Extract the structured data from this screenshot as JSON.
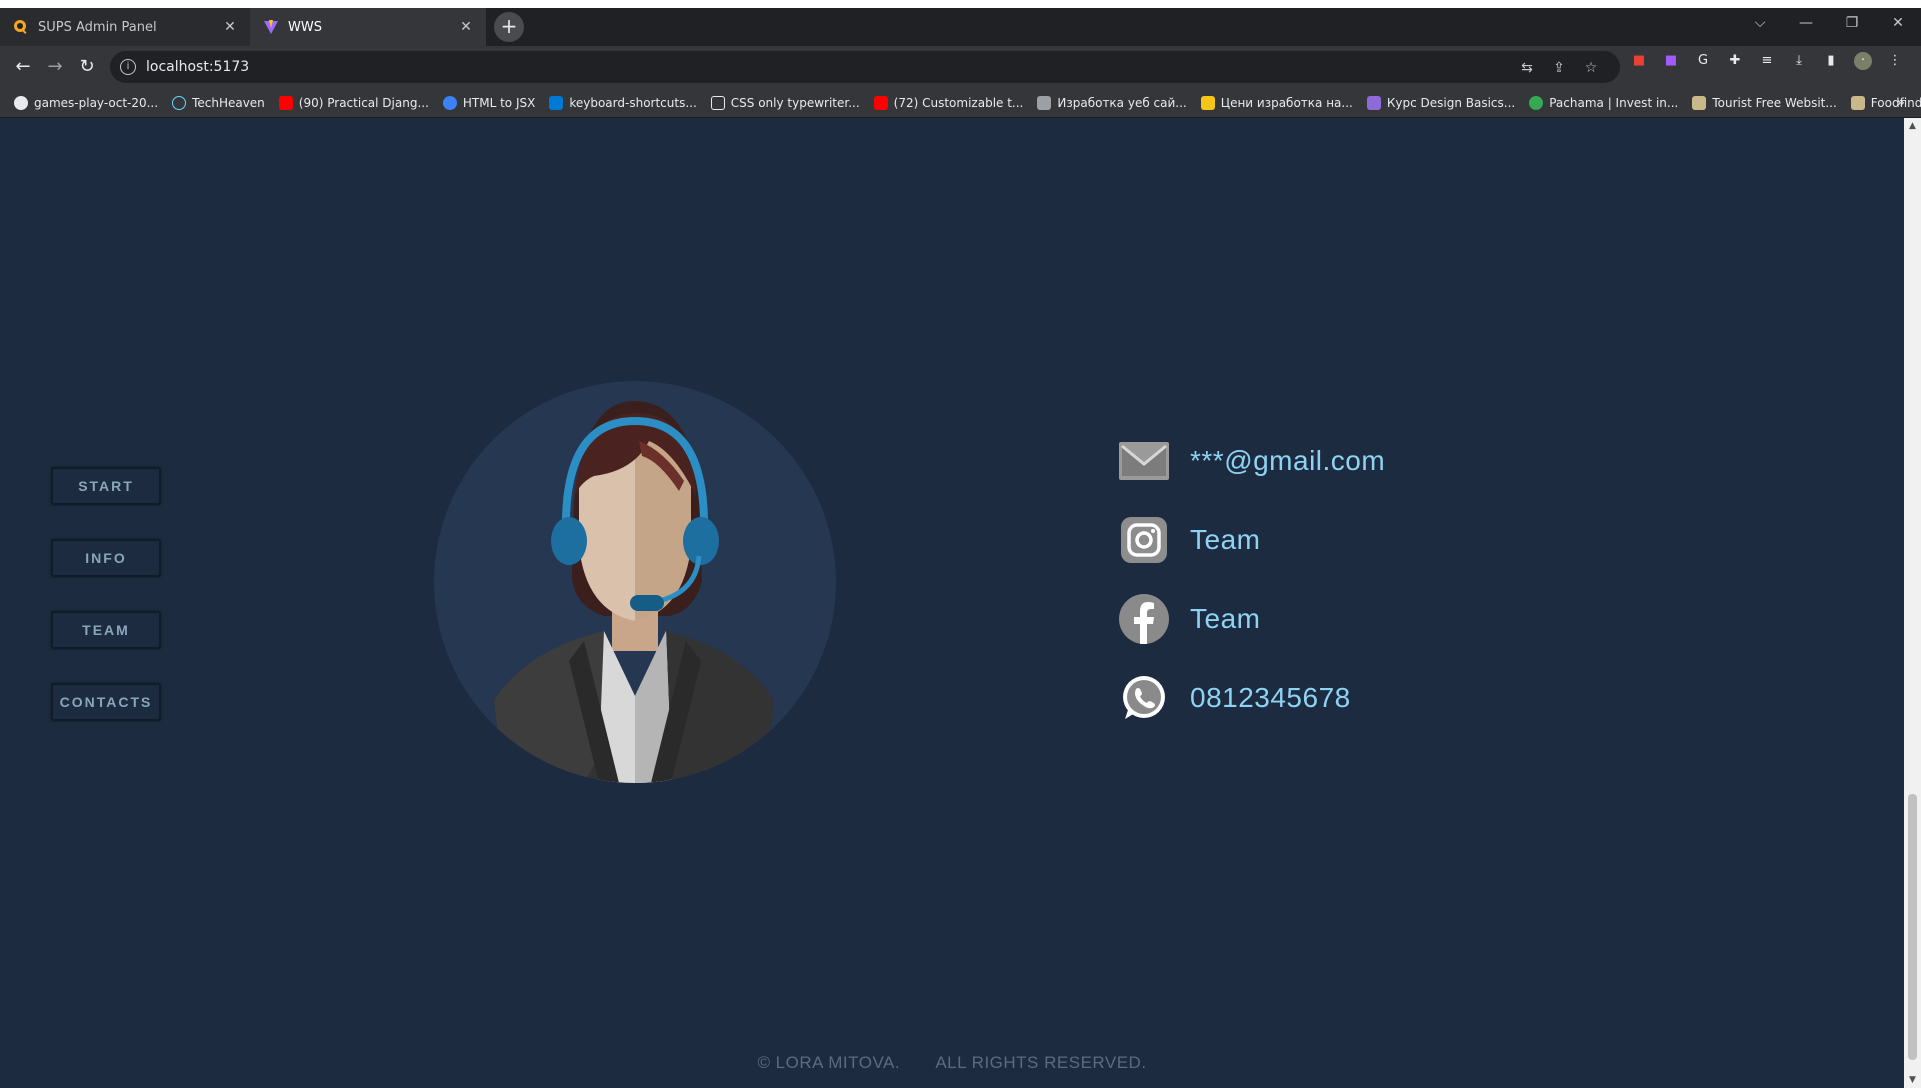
{
  "browser": {
    "tabs": [
      {
        "title": "SUPS Admin Panel",
        "active": false
      },
      {
        "title": "WWS",
        "active": true
      }
    ],
    "new_tab": "+",
    "window_controls": [
      "⌵",
      "—",
      "❐",
      "✕"
    ],
    "address": "localhost:5173",
    "bookmarks": [
      {
        "label": "games-play-oct-20...",
        "color": "#e8eaed"
      },
      {
        "label": "TechHeaven",
        "color": "#61dafb"
      },
      {
        "label": "(90) Practical Djang...",
        "color": "#ff0000"
      },
      {
        "label": "HTML to JSX",
        "color": "#3b82f6"
      },
      {
        "label": "keyboard-shortcuts...",
        "color": "#0078d4"
      },
      {
        "label": "CSS only typewriter...",
        "color": "#e8eaed"
      },
      {
        "label": "(72) Customizable t...",
        "color": "#ff0000"
      },
      {
        "label": "Изработка уеб сай...",
        "color": "#9aa0a6"
      },
      {
        "label": "Цени изработка на...",
        "color": "#f5c518"
      },
      {
        "label": "Курс Design Basics...",
        "color": "#8e6bd8"
      },
      {
        "label": "Pachama | Invest in...",
        "color": "#34a853"
      },
      {
        "label": "Tourist Free Websit...",
        "color": "#c9b98a"
      },
      {
        "label": "Foodfinda Free We...",
        "color": "#c9b98a"
      }
    ],
    "bookmarks_more": "»"
  },
  "sidenav": {
    "items": [
      "START",
      "INFO",
      "TEAM",
      "CONTACTS"
    ]
  },
  "contacts": {
    "email": "***@gmail.com",
    "instagram": "Team",
    "facebook": "Team",
    "phone": "0812345678"
  },
  "footer": {
    "copyright": "© LORA MITOVA.",
    "rights": "ALL RIGHTS RESERVED."
  },
  "colors": {
    "page_bg": "#1c2b3f",
    "avatar_circle": "#253751",
    "contact_text": "#8fd3f4",
    "nav_text": "#8aa6bd",
    "footer_text": "#5b6b80"
  }
}
